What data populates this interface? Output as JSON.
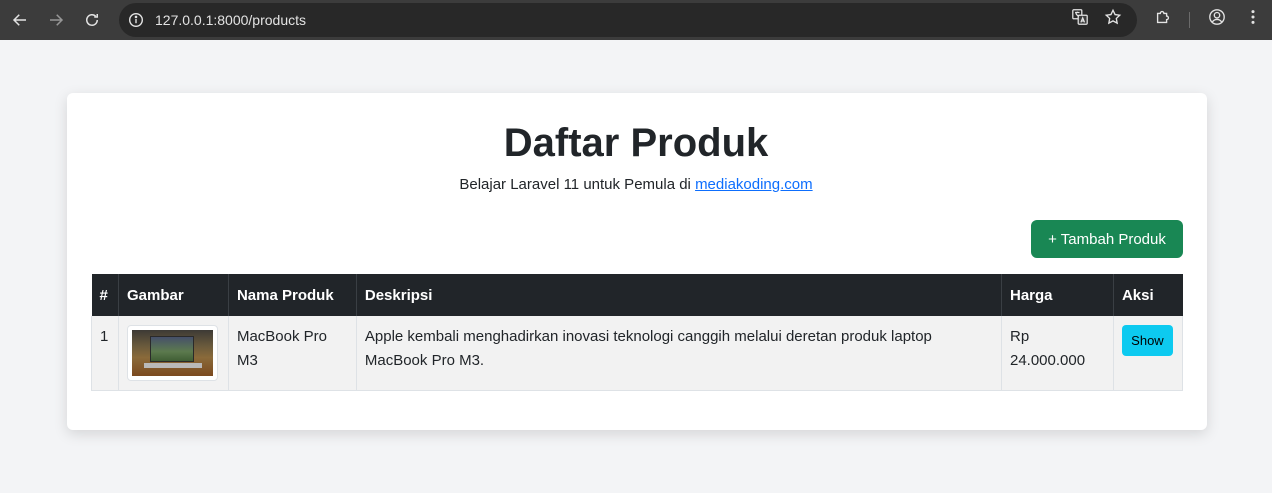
{
  "browser": {
    "url": "127.0.0.1:8000/products",
    "icons": [
      "back-icon",
      "forward-icon",
      "reload-icon",
      "site-info-icon",
      "translate-icon",
      "bookmark-star-icon",
      "extensions-icon",
      "profile-icon",
      "more-menu-icon"
    ]
  },
  "page": {
    "title": "Daftar Produk",
    "subtitle_text": "Belajar Laravel 11 untuk Pemula di ",
    "subtitle_link": "mediakoding.com",
    "add_button": "+ Tambah Produk"
  },
  "table": {
    "headers": {
      "no": "#",
      "image": "Gambar",
      "name": "Nama Produk",
      "description": "Deskripsi",
      "price": "Harga",
      "action": "Aksi"
    },
    "rows": [
      {
        "no": "1",
        "name": "MacBook Pro M3",
        "description": "Apple kembali menghadirkan inovasi teknologi canggih melalui deretan produk laptop MacBook Pro M3.",
        "price": "Rp 24.000.000",
        "action": "Show"
      }
    ]
  },
  "colors": {
    "add_button": "#198754",
    "show_button": "#0dcaf0",
    "table_header": "#212529",
    "link": "#0d6efd"
  }
}
